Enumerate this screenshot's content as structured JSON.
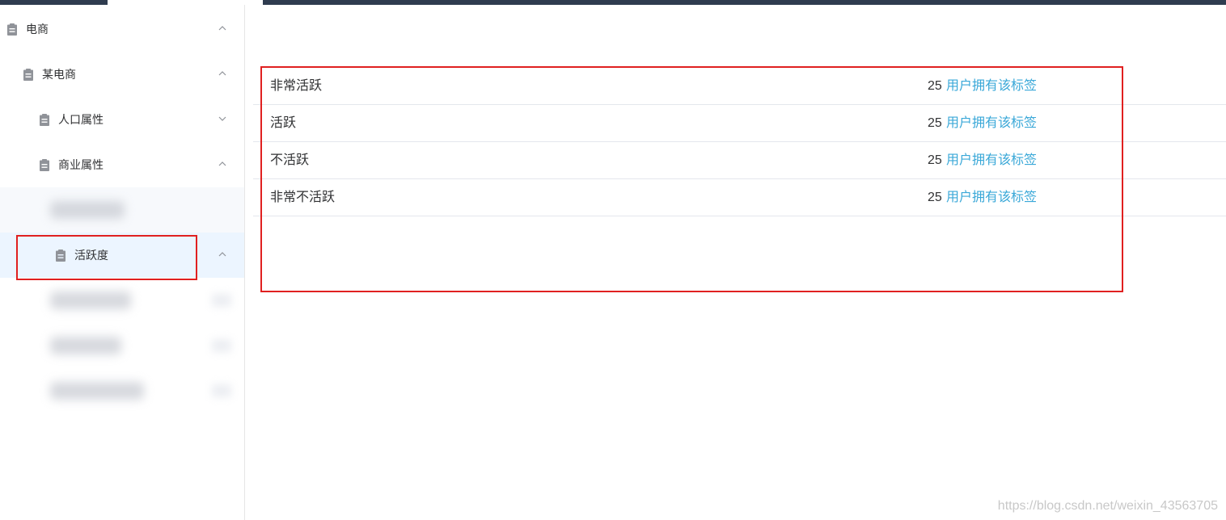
{
  "sidebar": {
    "items": [
      {
        "label": "电商",
        "icon": "clipboard-icon",
        "arrow": "chevron-up-icon"
      },
      {
        "label": "某电商",
        "icon": "clipboard-icon",
        "arrow": "chevron-up-icon"
      },
      {
        "label": "人口属性",
        "icon": "clipboard-icon",
        "arrow": "chevron-down-icon"
      },
      {
        "label": "商业属性",
        "icon": "clipboard-icon",
        "arrow": "chevron-up-icon"
      },
      {
        "label": "活跃度",
        "icon": "clipboard-icon",
        "arrow": "chevron-up-icon",
        "active": true
      }
    ]
  },
  "main": {
    "tags": [
      {
        "name": "非常活跃",
        "count": "25",
        "suffix": "用户拥有该标签"
      },
      {
        "name": "活跃",
        "count": "25",
        "suffix": "用户拥有该标签"
      },
      {
        "name": "不活跃",
        "count": "25",
        "suffix": "用户拥有该标签"
      },
      {
        "name": "非常不活跃",
        "count": "25",
        "suffix": "用户拥有该标签"
      }
    ]
  },
  "watermark": "https://blog.csdn.net/weixin_43563705",
  "colors": {
    "topbar": "#2f3c4f",
    "active_bg": "#ecf5ff",
    "link": "#3aa8d8",
    "highlight": "#e02020",
    "icon": "#909399"
  }
}
